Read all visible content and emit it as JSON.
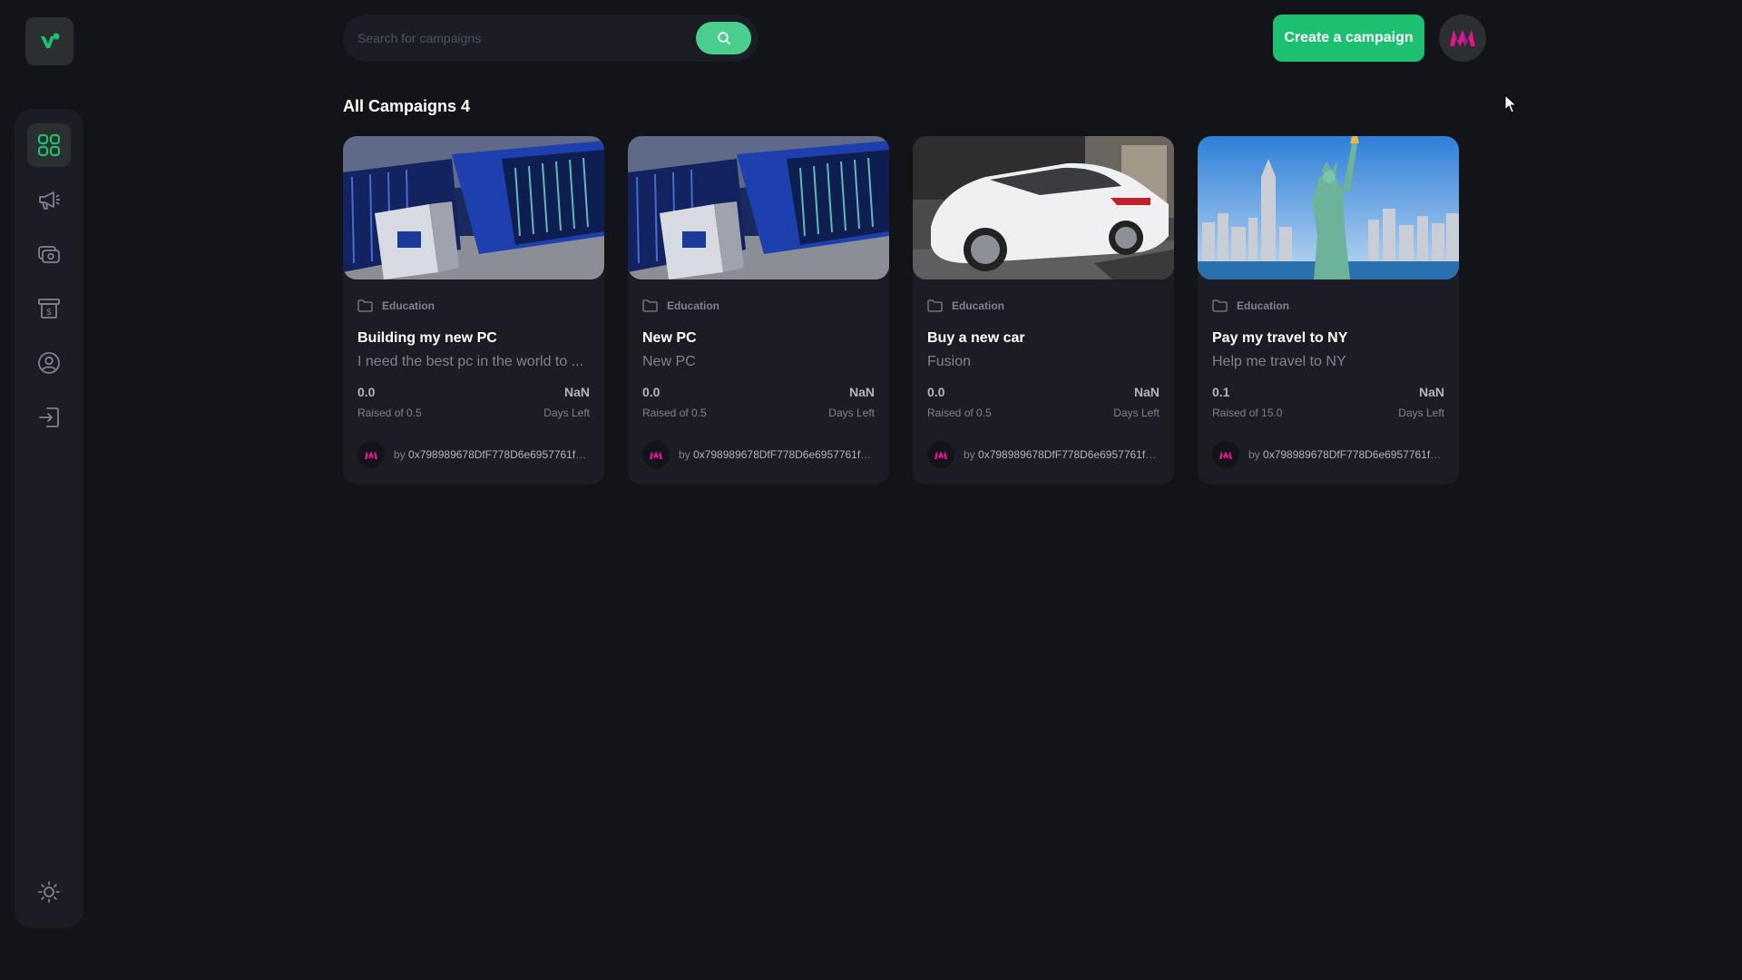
{
  "colors": {
    "background": "#13131a",
    "panel": "#1c1c24",
    "accent": "#4acd8d",
    "button": "#1dc071",
    "muted": "#808191"
  },
  "sidebar": {
    "logo_icon": "logo-icon",
    "items": [
      {
        "icon": "dashboard-icon",
        "active": true
      },
      {
        "icon": "campaign-icon",
        "active": false
      },
      {
        "icon": "payment-icon",
        "active": false
      },
      {
        "icon": "withdraw-icon",
        "active": false
      },
      {
        "icon": "profile-icon",
        "active": false
      },
      {
        "icon": "logout-icon",
        "active": false
      }
    ],
    "theme_icon": "sun-icon"
  },
  "header": {
    "search_placeholder": "Search for campaigns",
    "search_icon": "search-icon",
    "create_label": "Create a campaign",
    "avatar_icon": "metamask-avatar-icon"
  },
  "main": {
    "title": "All Campaigns 4"
  },
  "campaigns": [
    {
      "image": "supercomputer-photo",
      "category": "Education",
      "title": "Building my new PC",
      "description": "I need the best pc in the world to ...",
      "raised": "0.0",
      "raised_label": "Raised of 0.5",
      "days": "NaN",
      "days_label": "Days Left",
      "by": "by",
      "owner": "0x798989678DfF778D6e6957761f0..."
    },
    {
      "image": "supercomputer-photo",
      "category": "Education",
      "title": "New PC",
      "description": "New PC",
      "raised": "0.0",
      "raised_label": "Raised of 0.5",
      "days": "NaN",
      "days_label": "Days Left",
      "by": "by",
      "owner": "0x798989678DfF778D6e6957761f0..."
    },
    {
      "image": "white-car-photo",
      "category": "Education",
      "title": "Buy a new car",
      "description": "Fusion",
      "raised": "0.0",
      "raised_label": "Raised of 0.5",
      "days": "NaN",
      "days_label": "Days Left",
      "by": "by",
      "owner": "0x798989678DfF778D6e6957761f0..."
    },
    {
      "image": "statue-of-liberty-photo",
      "category": "Education",
      "title": "Pay my travel to NY",
      "description": "Help me travel to NY",
      "raised": "0.1",
      "raised_label": "Raised of 15.0",
      "days": "NaN",
      "days_label": "Days Left",
      "by": "by",
      "owner": "0x798989678DfF778D6e6957761f0..."
    }
  ]
}
